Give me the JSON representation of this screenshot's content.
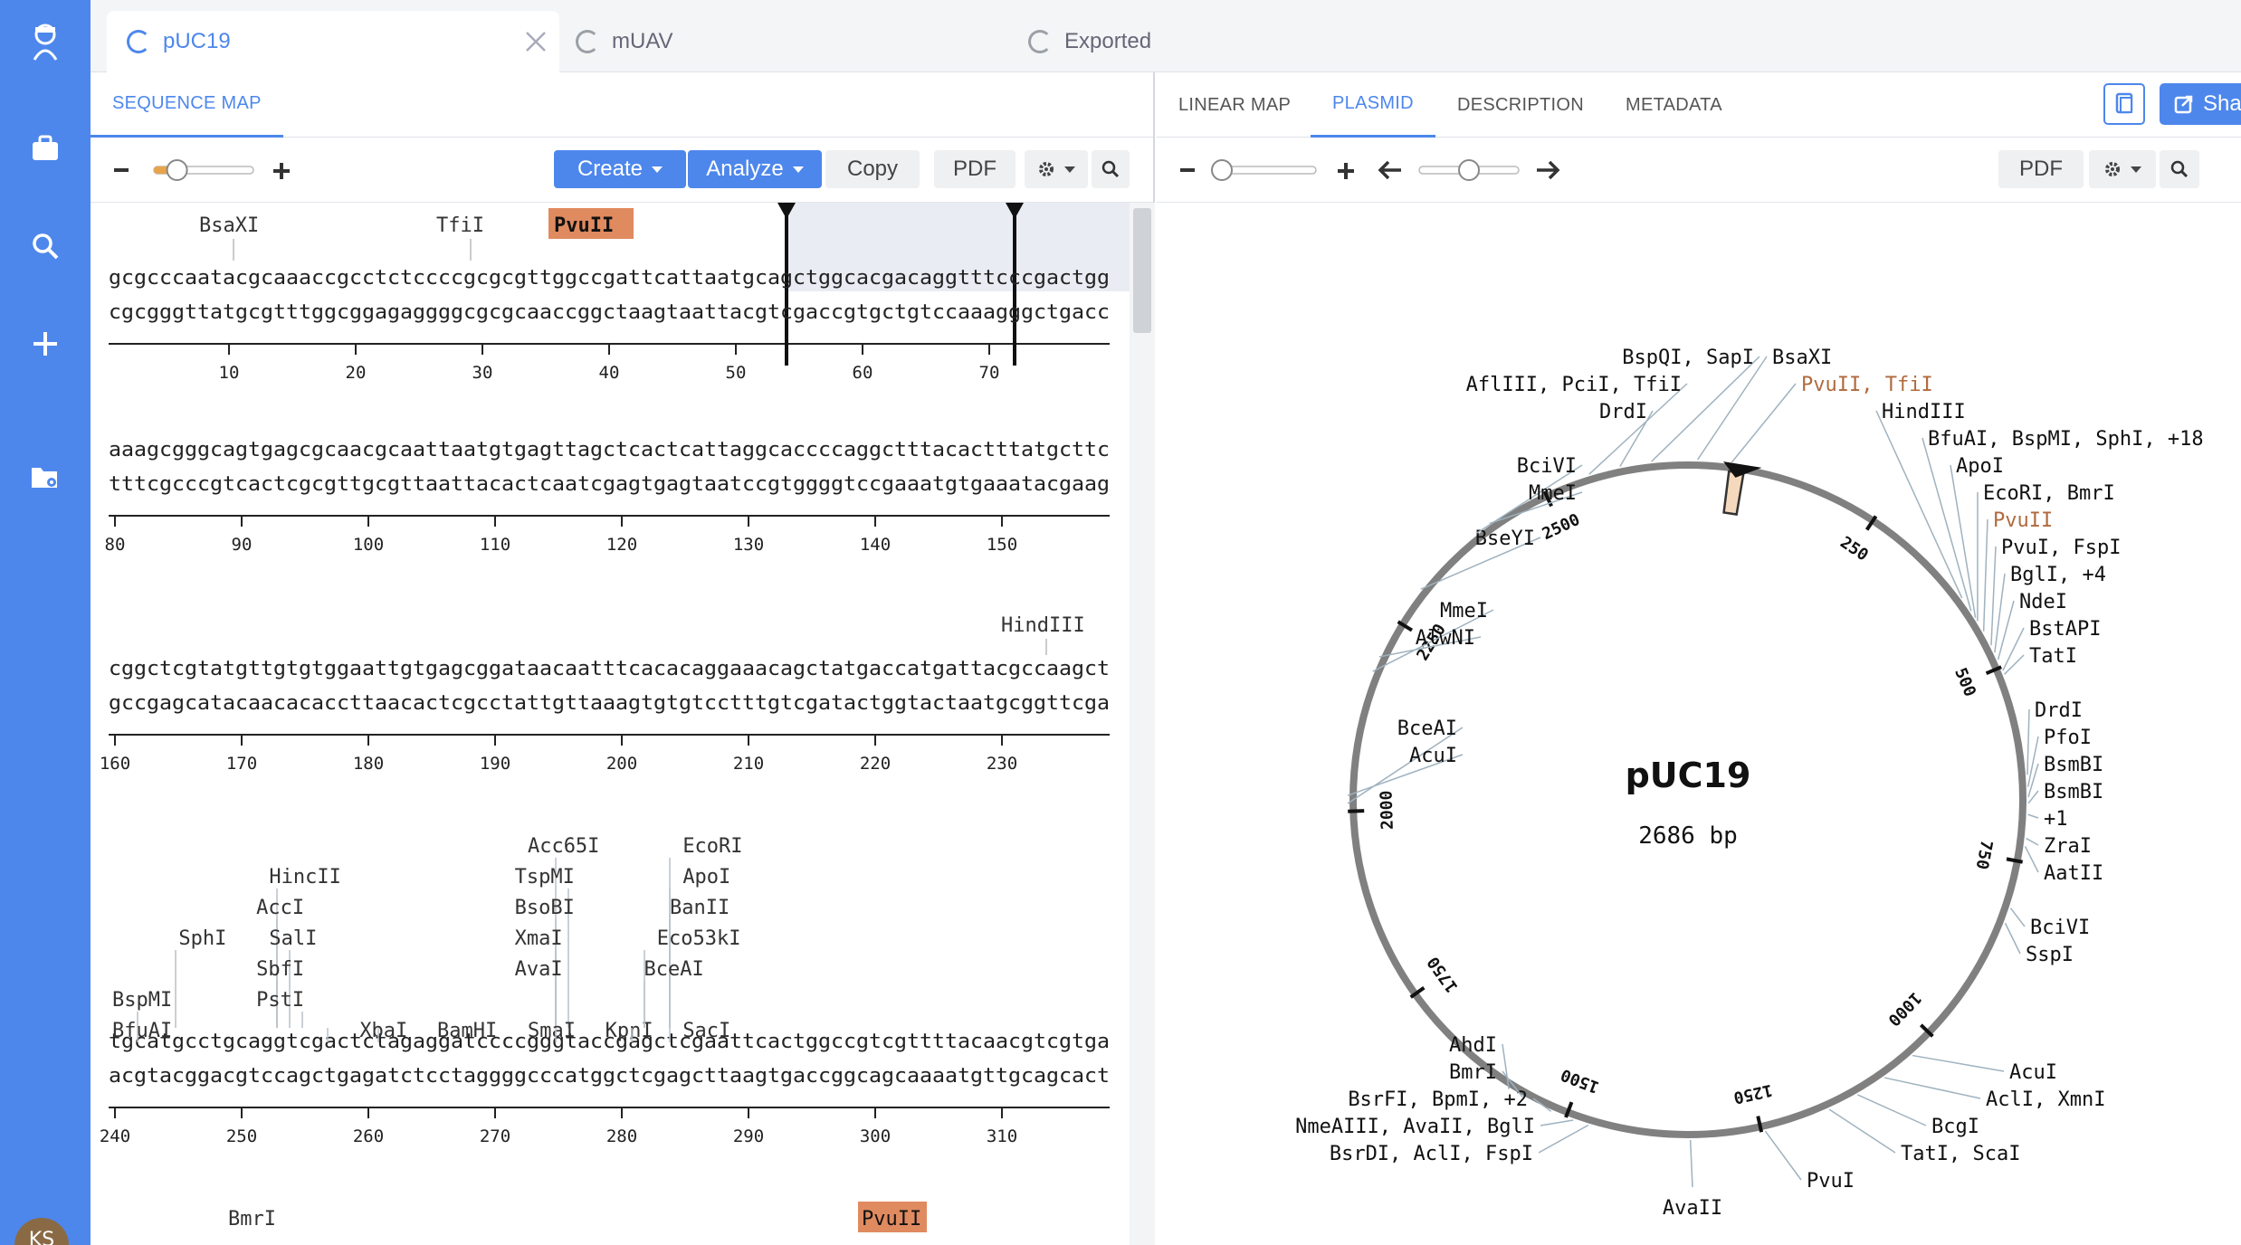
{
  "tabs": [
    {
      "label": "pUC19"
    },
    {
      "label": "mUAV"
    },
    {
      "label": "Exported"
    }
  ],
  "left_pane": {
    "tab": "SEQUENCE MAP",
    "toolbar": {
      "create": "Create",
      "analyze": "Analyze",
      "copy": "Copy",
      "pdf": "PDF"
    },
    "zoom_level": 0.2,
    "rows": [
      {
        "top": "gcgcccaatacgcaaaccgcctctccccgcgcgttggccgattcattaatgcagctggcacgacaggtttcccgactgg",
        "bottom": "cgcgggttatgcgtttggcggagaggggcgcgcaaccggctaagtaattacgtcgaccgtgctgtccaaagggctgacc",
        "ticks": [
          "10",
          "20",
          "30",
          "40",
          "50",
          "60",
          "70"
        ],
        "enzymes": [
          {
            "name": "BsaXI"
          },
          {
            "name": "TfiI"
          },
          {
            "name": "PvuII"
          }
        ]
      },
      {
        "top": "aaagcgggcagtgagcgcaacgcaattaatgtgagttagctcactcattaggcaccccaggctttacactttatgcttc",
        "bottom": "tttcgcccgtcactcgcgttgcgttaattacactcaatcgagtgagtaatccgtggggtccgaaatgtgaaatacgaag",
        "ticks": [
          "80",
          "90",
          "100",
          "110",
          "120",
          "130",
          "140",
          "150"
        ],
        "enzymes": []
      },
      {
        "top": "cggctcgtatgttgtgtggaattgtgagcggataacaatttcacacaggaaacagctatgaccatgattacgccaagct",
        "bottom": "gccgagcatacaacacaccttaacactcgcctattgttaaagtgtgtcctttgtcgatactggtactaatgcggttcga",
        "ticks": [
          "160",
          "170",
          "180",
          "190",
          "200",
          "210",
          "220",
          "230"
        ],
        "enzymes": [
          {
            "name": "HindIII"
          }
        ]
      },
      {
        "top": "tgcatgcctgcaggtcgactctagaggatccccgggtaccgagctcgaattcactggccgtcgttttacaacgtcgtga",
        "bottom": "acgtacggacgtccagctgagatctcctaggggcccatggctcgagcttaagtgaccggcagcaaaatgttgcagcact",
        "ticks": [
          "240",
          "250",
          "260",
          "270",
          "280",
          "290",
          "300",
          "310"
        ],
        "enzymes": [
          {
            "name": "BspMI"
          },
          {
            "name": "BfuAI"
          },
          {
            "name": "SphI"
          },
          {
            "name": "HincII"
          },
          {
            "name": "AccI"
          },
          {
            "name": "SalI"
          },
          {
            "name": "SbfI"
          },
          {
            "name": "PstI"
          },
          {
            "name": "XbaI"
          },
          {
            "name": "BamHI"
          },
          {
            "name": "Acc65I"
          },
          {
            "name": "TspMI"
          },
          {
            "name": "BsoBI"
          },
          {
            "name": "XmaI"
          },
          {
            "name": "AvaI"
          },
          {
            "name": "SmaI"
          },
          {
            "name": "KpnI"
          },
          {
            "name": "EcoRI"
          },
          {
            "name": "ApoI"
          },
          {
            "name": "BanII"
          },
          {
            "name": "Eco53kI"
          },
          {
            "name": "BceAI"
          },
          {
            "name": "SacI"
          }
        ]
      },
      {
        "top": "",
        "bottom": "",
        "ticks": [],
        "enzymes": [
          {
            "name": "BmrI"
          },
          {
            "name": "PvuII"
          }
        ]
      }
    ]
  },
  "right_pane": {
    "tabs": [
      "LINEAR MAP",
      "PLASMID",
      "DESCRIPTION",
      "METADATA"
    ],
    "active_tab": "PLASMID",
    "share_label": "Sha",
    "pdf": "PDF",
    "zoom_level": 0.0,
    "rotation_level": 0.5,
    "plasmid": {
      "name": "pUC19",
      "length_label": "2686 bp",
      "length": 2686,
      "ticks": [
        "250",
        "500",
        "750",
        "1000",
        "1250",
        "1500",
        "1750",
        "2000",
        "2250",
        "2500"
      ],
      "labels": [
        {
          "text": "BsaXI"
        },
        {
          "text": "PvuII, TfiI"
        },
        {
          "text": "HindIII"
        },
        {
          "text": "BfuAI, BspMI, SphI, +18"
        },
        {
          "text": "ApoI"
        },
        {
          "text": "EcoRI, BmrI"
        },
        {
          "text": "PvuII"
        },
        {
          "text": "PvuI, FspI"
        },
        {
          "text": "BglI, +4"
        },
        {
          "text": "NdeI"
        },
        {
          "text": "BstAPI"
        },
        {
          "text": "TatI"
        },
        {
          "text": "DrdI"
        },
        {
          "text": "PfoI"
        },
        {
          "text": "BsmBI"
        },
        {
          "text": "BsmBI"
        },
        {
          "text": "+1"
        },
        {
          "text": "ZraI"
        },
        {
          "text": "AatII"
        },
        {
          "text": "BciVI"
        },
        {
          "text": "SspI"
        },
        {
          "text": "AcuI"
        },
        {
          "text": "AclI, XmnI"
        },
        {
          "text": "BcgI"
        },
        {
          "text": "TatI, ScaI"
        },
        {
          "text": "PvuI"
        },
        {
          "text": "AvaII"
        },
        {
          "text": "BsrDI, AclI, FspI"
        },
        {
          "text": "NmeAIII, AvaII, BglI"
        },
        {
          "text": "BsrFI, BpmI, +2"
        },
        {
          "text": "BmrI"
        },
        {
          "text": "AhdI"
        },
        {
          "text": "BceAI"
        },
        {
          "text": "AcuI"
        },
        {
          "text": "MmeI"
        },
        {
          "text": "AlwNI"
        },
        {
          "text": "BseYI"
        },
        {
          "text": "BciVI"
        },
        {
          "text": "MmeI"
        },
        {
          "text": "AflIII, PciI, TfiI"
        },
        {
          "text": "DrdI"
        },
        {
          "text": "BspQI, SapI"
        }
      ]
    }
  },
  "user": {
    "initials": "KS"
  },
  "colors": {
    "accent": "#4d87ec",
    "highlight": "#e08a60",
    "plasmid_ring": "#808080"
  }
}
